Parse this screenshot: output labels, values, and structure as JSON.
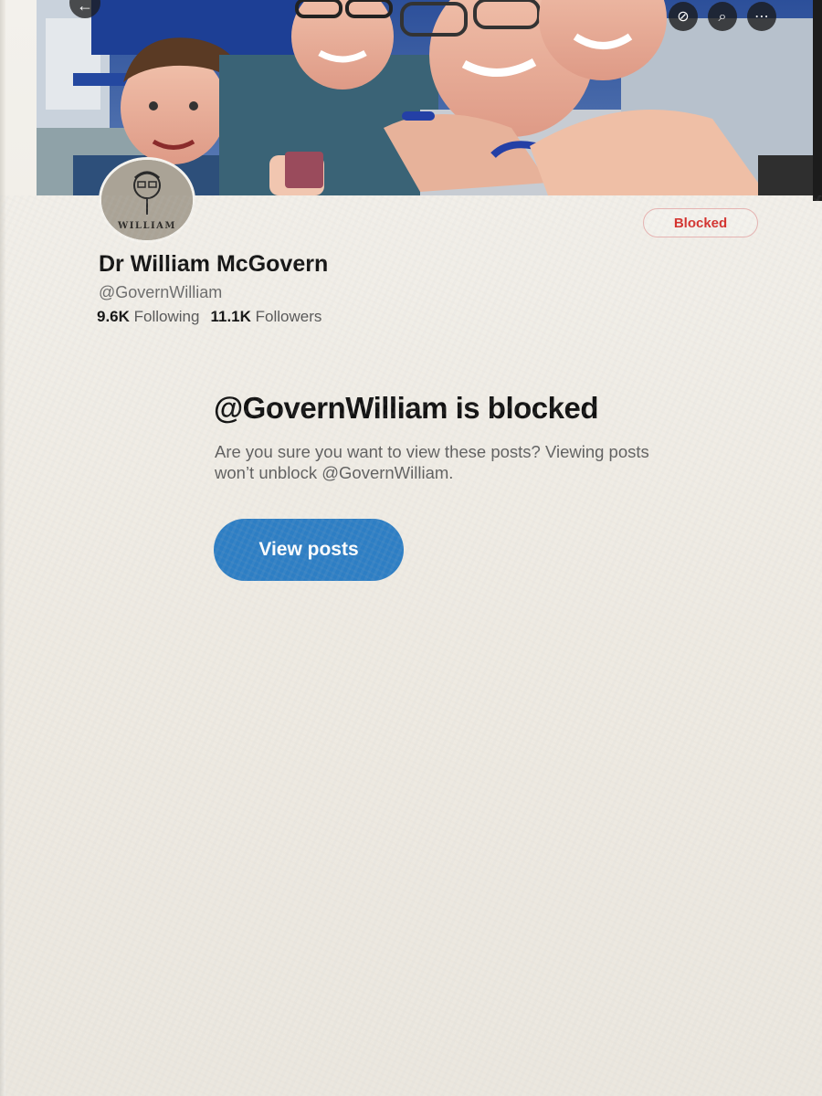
{
  "profile": {
    "display_name": "Dr William McGovern",
    "handle": "@GovernWilliam",
    "following_count": "9.6K",
    "following_label": "Following",
    "followers_count": "11.1K",
    "followers_label": "Followers",
    "avatar_caption": "WILLIAM",
    "blocked_label": "Blocked"
  },
  "header": {
    "back_icon": "arrow-left-icon",
    "icons": [
      "grok-icon",
      "search-icon",
      "more-icon"
    ]
  },
  "notice": {
    "title": "@GovernWilliam is blocked",
    "body": "Are you sure you want to view these posts? Viewing posts won’t unblock @GovernWilliam.",
    "button_label": "View posts"
  },
  "colors": {
    "accent": "#2d7ec4",
    "blocked_text": "#d4302c",
    "blocked_border": "#e7b3b1"
  }
}
